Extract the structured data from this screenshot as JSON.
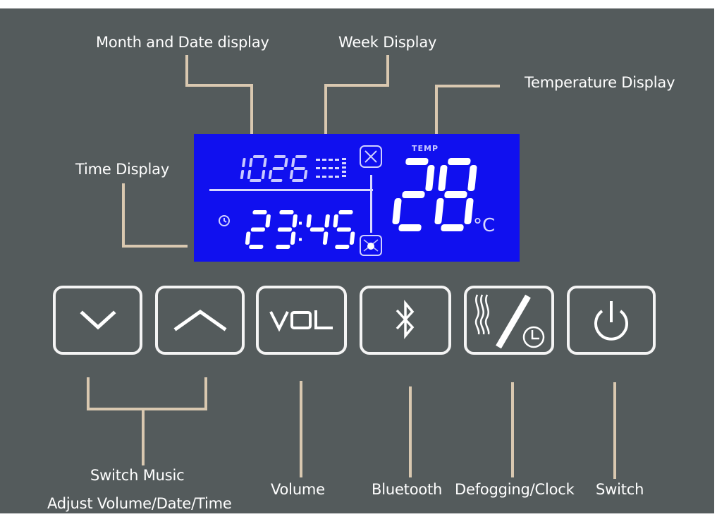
{
  "annotations": {
    "month_date": "Month and Date display",
    "week": "Week Display",
    "temperature": "Temperature Display",
    "time": "Time Display",
    "switch_music": "Switch Music",
    "adjust": "Adjust Volume/Date/Time",
    "volume": "Volume",
    "bluetooth": "Bluetooth",
    "defog_clock": "Defogging/Clock",
    "switch": "Switch"
  },
  "lcd": {
    "date": "1026",
    "time": "23:45",
    "temp_label": "TEMP",
    "temperature": "28",
    "temp_unit": "°C",
    "colors": {
      "background": "#1010ef",
      "segment": "#ffffff",
      "faint": "#c8c8ff"
    }
  },
  "buttons": [
    {
      "id": "down",
      "icon": "chevron-down-icon"
    },
    {
      "id": "up",
      "icon": "chevron-up-icon"
    },
    {
      "id": "volume",
      "label": "VOL",
      "icon": "vol-text"
    },
    {
      "id": "bluetooth",
      "icon": "bluetooth-icon"
    },
    {
      "id": "defog-clock",
      "icon": "defog-clock-icon"
    },
    {
      "id": "power",
      "icon": "power-icon"
    }
  ],
  "colors": {
    "panel": "#545b5c",
    "leader_line": "#d9c8b0",
    "text": "#ffffff",
    "button_border": "#f4f4f4"
  }
}
